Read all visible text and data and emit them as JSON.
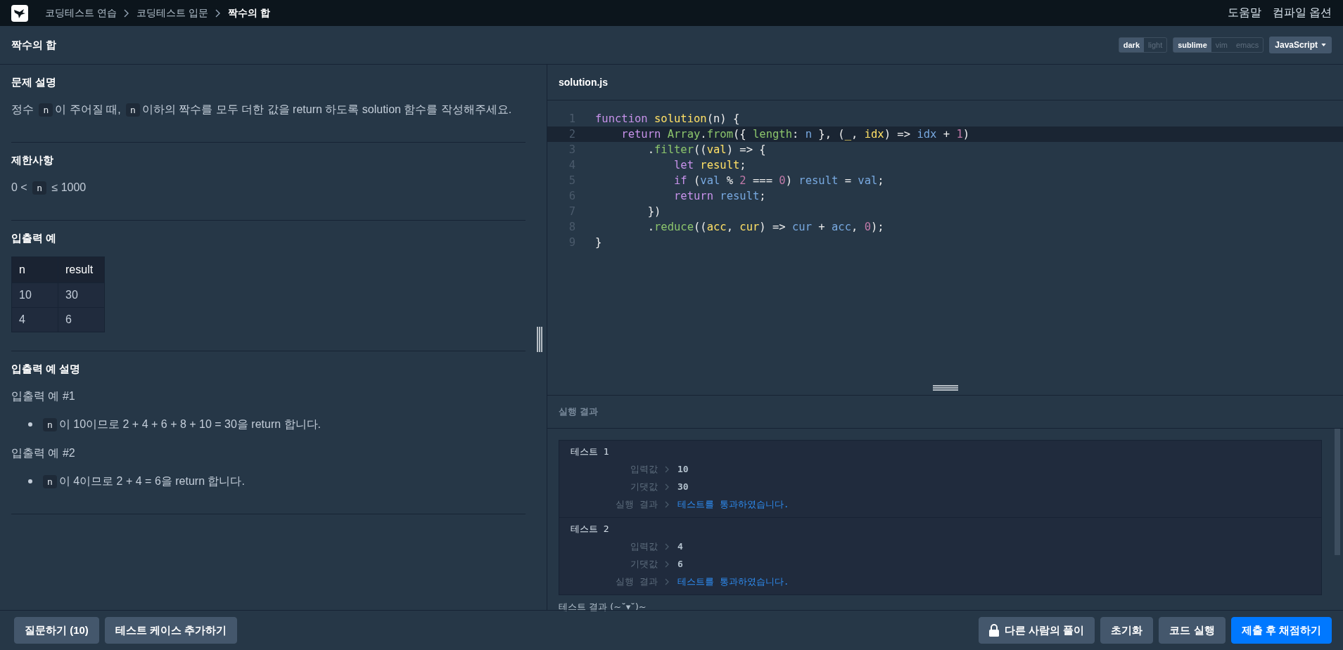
{
  "nav": {
    "breadcrumbs": [
      {
        "label": "코딩테스트 연습",
        "current": false
      },
      {
        "label": "코딩테스트 입문",
        "current": false
      },
      {
        "label": "짝수의 합",
        "current": true
      }
    ],
    "links": [
      "도움말",
      "컴파일 옵션"
    ]
  },
  "title_bar": {
    "title": "짝수의 합",
    "themes": [
      {
        "label": "dark",
        "selected": true
      },
      {
        "label": "light",
        "selected": false
      }
    ],
    "keymaps": [
      {
        "label": "sublime",
        "selected": true
      },
      {
        "label": "vim",
        "selected": false
      },
      {
        "label": "emacs",
        "selected": false
      }
    ],
    "language": "JavaScript"
  },
  "problem": {
    "sections": [
      {
        "heading": "문제 설명",
        "blocks": [
          {
            "kind": "paragraph",
            "segments": [
              {
                "kind": "text",
                "text": "정수 "
              },
              {
                "kind": "code",
                "text": "n"
              },
              {
                "kind": "text",
                "text": "이 주어질 때, "
              },
              {
                "kind": "code",
                "text": "n"
              },
              {
                "kind": "text",
                "text": "이하의 짝수를 모두 더한 값을 return 하도록 solution 함수를 작성해주세요."
              }
            ]
          }
        ]
      },
      {
        "heading": "제한사항",
        "blocks": [
          {
            "kind": "paragraph",
            "segments": [
              {
                "kind": "text",
                "text": "0 < "
              },
              {
                "kind": "code",
                "text": "n"
              },
              {
                "kind": "text",
                "text": " ≤ 1000"
              }
            ]
          }
        ]
      },
      {
        "heading": "입출력 예",
        "blocks": [
          {
            "kind": "table",
            "columns": [
              "n",
              "result"
            ],
            "rows": [
              [
                "10",
                "30"
              ],
              [
                "4",
                "6"
              ]
            ]
          }
        ]
      },
      {
        "heading": "입출력 예 설명",
        "blocks": [
          {
            "kind": "subheading",
            "text": "입출력 예 #1"
          },
          {
            "kind": "bullet",
            "segments": [
              {
                "kind": "code",
                "text": "n"
              },
              {
                "kind": "text",
                "text": "이 10이므로 2 + 4 + 6 + 8 + 10 = 30을 return 합니다."
              }
            ]
          },
          {
            "kind": "subheading",
            "text": "입출력 예 #2"
          },
          {
            "kind": "bullet",
            "segments": [
              {
                "kind": "code",
                "text": "n"
              },
              {
                "kind": "text",
                "text": "이 4이므로 2 + 4 = 6을 return 합니다."
              }
            ]
          }
        ]
      }
    ]
  },
  "editor": {
    "filename": "solution.js",
    "lines": [
      {
        "number": "1",
        "active": false,
        "tokens": [
          {
            "kind": "kw",
            "text": "function"
          },
          {
            "kind": "fn",
            "text": " solution"
          },
          {
            "kind": "punc",
            "text": "(n) {"
          }
        ]
      },
      {
        "number": "2",
        "active": true,
        "tokens": [
          {
            "kind": "kw",
            "text": "    return"
          },
          {
            "kind": "builtin",
            "text": " Array"
          },
          {
            "kind": "punc",
            "text": "."
          },
          {
            "kind": "builtin",
            "text": "from"
          },
          {
            "kind": "punc",
            "text": "({ "
          },
          {
            "kind": "builtin",
            "text": "length"
          },
          {
            "kind": "punc",
            "text": ": "
          },
          {
            "kind": "var",
            "text": "n"
          },
          {
            "kind": "punc",
            "text": " }, ("
          },
          {
            "kind": "fn",
            "text": "_"
          },
          {
            "kind": "punc",
            "text": ", "
          },
          {
            "kind": "fn",
            "text": "idx"
          },
          {
            "kind": "punc",
            "text": ") => "
          },
          {
            "kind": "var",
            "text": "idx"
          },
          {
            "kind": "punc",
            "text": " + "
          },
          {
            "kind": "num",
            "text": "1"
          },
          {
            "kind": "punc",
            "text": ")"
          }
        ]
      },
      {
        "number": "3",
        "active": false,
        "tokens": [
          {
            "kind": "punc",
            "text": "        ."
          },
          {
            "kind": "builtin",
            "text": "filter"
          },
          {
            "kind": "punc",
            "text": "(("
          },
          {
            "kind": "fn",
            "text": "val"
          },
          {
            "kind": "punc",
            "text": ") => {"
          }
        ]
      },
      {
        "number": "4",
        "active": false,
        "tokens": [
          {
            "kind": "kw",
            "text": "            let"
          },
          {
            "kind": "fn",
            "text": " result"
          },
          {
            "kind": "punc",
            "text": ";"
          }
        ]
      },
      {
        "number": "5",
        "active": false,
        "tokens": [
          {
            "kind": "kw",
            "text": "            if"
          },
          {
            "kind": "punc",
            "text": " ("
          },
          {
            "kind": "var",
            "text": "val"
          },
          {
            "kind": "punc",
            "text": " % "
          },
          {
            "kind": "num",
            "text": "2"
          },
          {
            "kind": "punc",
            "text": " === "
          },
          {
            "kind": "num",
            "text": "0"
          },
          {
            "kind": "punc",
            "text": ") "
          },
          {
            "kind": "var",
            "text": "result"
          },
          {
            "kind": "punc",
            "text": " = "
          },
          {
            "kind": "var",
            "text": "val"
          },
          {
            "kind": "punc",
            "text": ";"
          }
        ]
      },
      {
        "number": "6",
        "active": false,
        "tokens": [
          {
            "kind": "kw",
            "text": "            return"
          },
          {
            "kind": "var",
            "text": " result"
          },
          {
            "kind": "punc",
            "text": ";"
          }
        ]
      },
      {
        "number": "7",
        "active": false,
        "tokens": [
          {
            "kind": "punc",
            "text": "        })"
          }
        ]
      },
      {
        "number": "8",
        "active": false,
        "tokens": [
          {
            "kind": "punc",
            "text": "        ."
          },
          {
            "kind": "builtin",
            "text": "reduce"
          },
          {
            "kind": "punc",
            "text": "(("
          },
          {
            "kind": "fn",
            "text": "acc"
          },
          {
            "kind": "punc",
            "text": ", "
          },
          {
            "kind": "fn",
            "text": "cur"
          },
          {
            "kind": "punc",
            "text": ") => "
          },
          {
            "kind": "var",
            "text": "cur"
          },
          {
            "kind": "punc",
            "text": " + "
          },
          {
            "kind": "var",
            "text": "acc"
          },
          {
            "kind": "punc",
            "text": ", "
          },
          {
            "kind": "num",
            "text": "0"
          },
          {
            "kind": "punc",
            "text": ");"
          }
        ]
      },
      {
        "number": "9",
        "active": false,
        "tokens": [
          {
            "kind": "punc",
            "text": "}"
          }
        ]
      }
    ]
  },
  "results": {
    "title": "실행 결과",
    "tests": [
      {
        "title": "테스트 1",
        "fields": [
          {
            "label": "입력값",
            "value": "10",
            "kind": "plain"
          },
          {
            "label": "기댓값",
            "value": "30",
            "kind": "plain"
          },
          {
            "label": "실행 결과",
            "value": "테스트를 통과하였습니다.",
            "kind": "pass"
          }
        ]
      },
      {
        "title": "테스트 2",
        "fields": [
          {
            "label": "입력값",
            "value": "4",
            "kind": "plain"
          },
          {
            "label": "기댓값",
            "value": "6",
            "kind": "plain"
          },
          {
            "label": "실행 결과",
            "value": "테스트를 통과하였습니다.",
            "kind": "pass"
          }
        ]
      }
    ],
    "summary": "테스트 결과 (~˘▾˘)~"
  },
  "footer": {
    "left_buttons": [
      {
        "label": "질문하기 (10)",
        "kind": "plain"
      },
      {
        "label": "테스트 케이스 추가하기",
        "kind": "plain"
      }
    ],
    "right_buttons": [
      {
        "label": "다른 사람의 풀이",
        "kind": "locked"
      },
      {
        "label": "초기화",
        "kind": "plain"
      },
      {
        "label": "코드 실행",
        "kind": "plain"
      },
      {
        "label": "제출 후 채점하기",
        "kind": "primary"
      }
    ]
  }
}
